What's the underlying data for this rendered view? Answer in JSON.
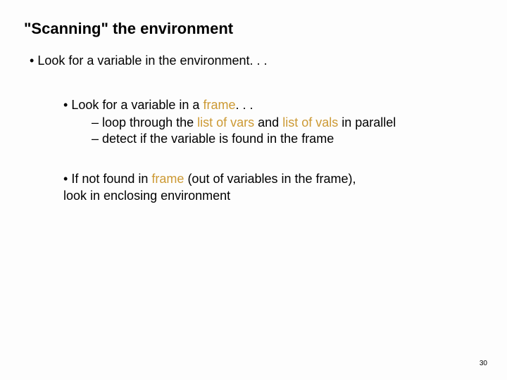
{
  "title": "\"Scanning\" the environment",
  "l1": {
    "bullet": "•",
    "text": "Look for a variable in the environment. . ."
  },
  "l2a": {
    "bullet": "•",
    "pre": "Look for a variable in a ",
    "hl": "frame",
    "post": ". . ."
  },
  "l3a": {
    "dash": "–",
    "pre": " loop through the ",
    "hl1": "list of vars",
    "mid": " and ",
    "hl2": "list of vals",
    "post": " in parallel"
  },
  "l3b": {
    "dash": "–",
    "text": " detect if the variable is found in the frame"
  },
  "l2b": {
    "bullet": "•",
    "pre": "If not found in ",
    "hl": "frame",
    "post1": " (out of variables in the frame),",
    "post2": "look in enclosing environment"
  },
  "pagenum": "30"
}
